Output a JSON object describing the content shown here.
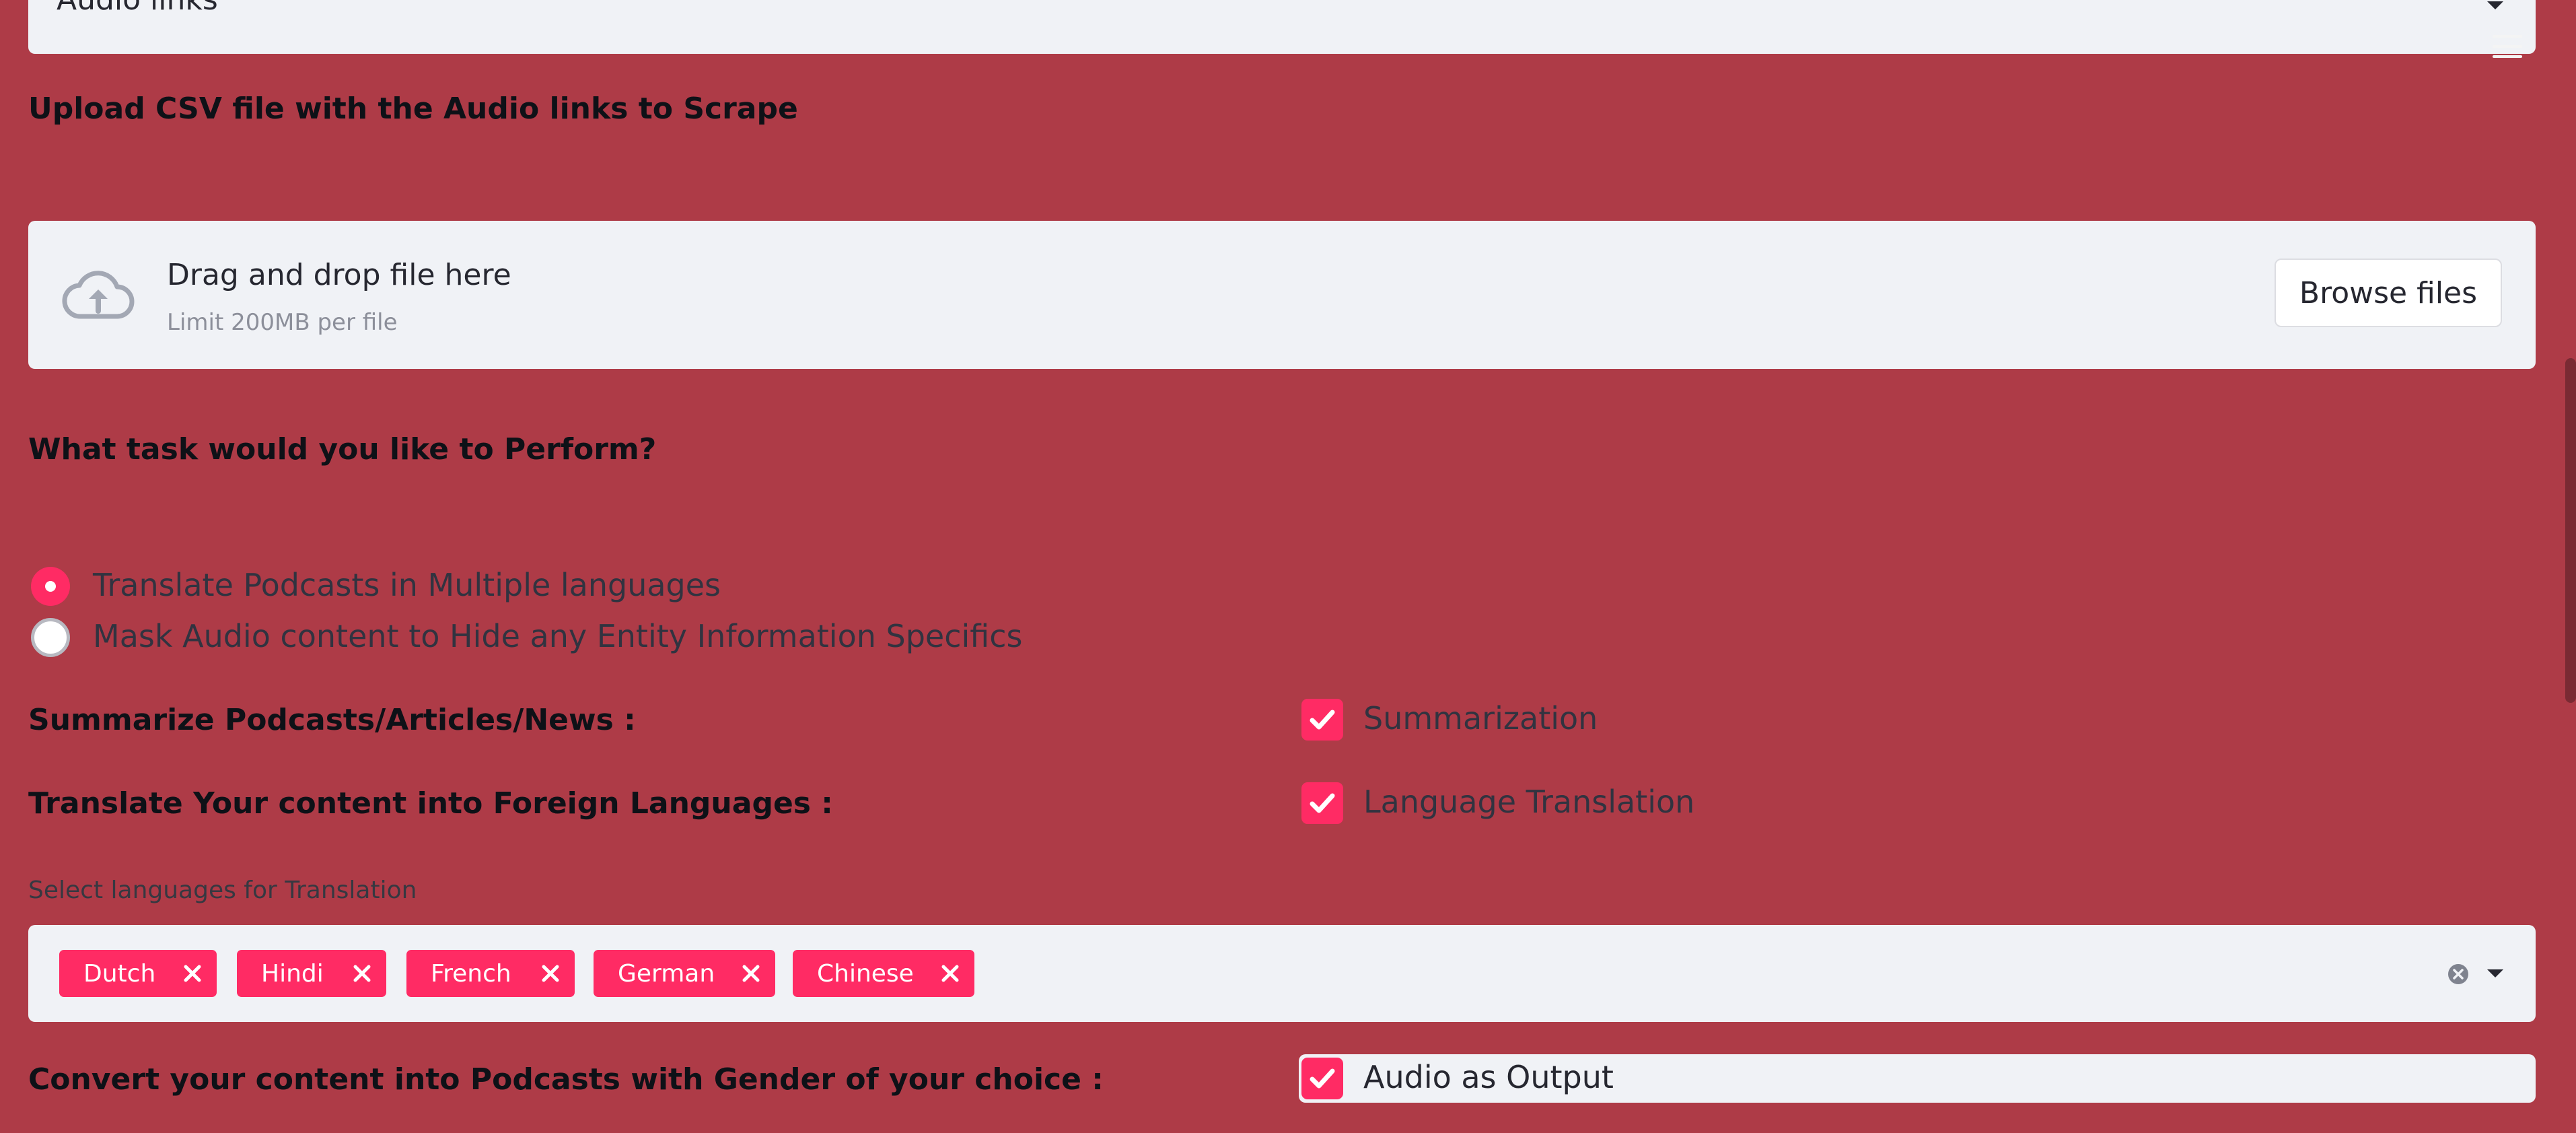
{
  "top_select": {
    "value": "Audio links"
  },
  "upload": {
    "heading": "Upload CSV file with the Audio links to Scrape",
    "dropzone_title": "Drag and drop file here",
    "dropzone_limit": "Limit 200MB per file",
    "browse_label": "Browse files"
  },
  "task": {
    "heading": "What task would you like to Perform?",
    "options": [
      {
        "label": "Translate Podcasts in Multiple languages",
        "selected": true
      },
      {
        "label": "Mask Audio content to Hide any Entity Information Specifics",
        "selected": false
      }
    ]
  },
  "summarize": {
    "label": "Summarize Podcasts/Articles/News :",
    "checkbox_label": "Summarization",
    "checked": true
  },
  "translate": {
    "label": "Translate Your content into Foreign Languages :",
    "checkbox_label": "Language Translation",
    "checked": true
  },
  "languages": {
    "label": "Select languages for Translation",
    "selected": [
      "Dutch",
      "Hindi",
      "French",
      "German",
      "Chinese"
    ]
  },
  "podcast": {
    "label": "Convert your content into Podcasts with Gender of your choice :",
    "checkbox_label": "Audio as Output",
    "checked": true
  },
  "colors": {
    "background": "#ae3b47",
    "accent": "#ff2b64",
    "widget_bg": "#f0f2f6"
  }
}
